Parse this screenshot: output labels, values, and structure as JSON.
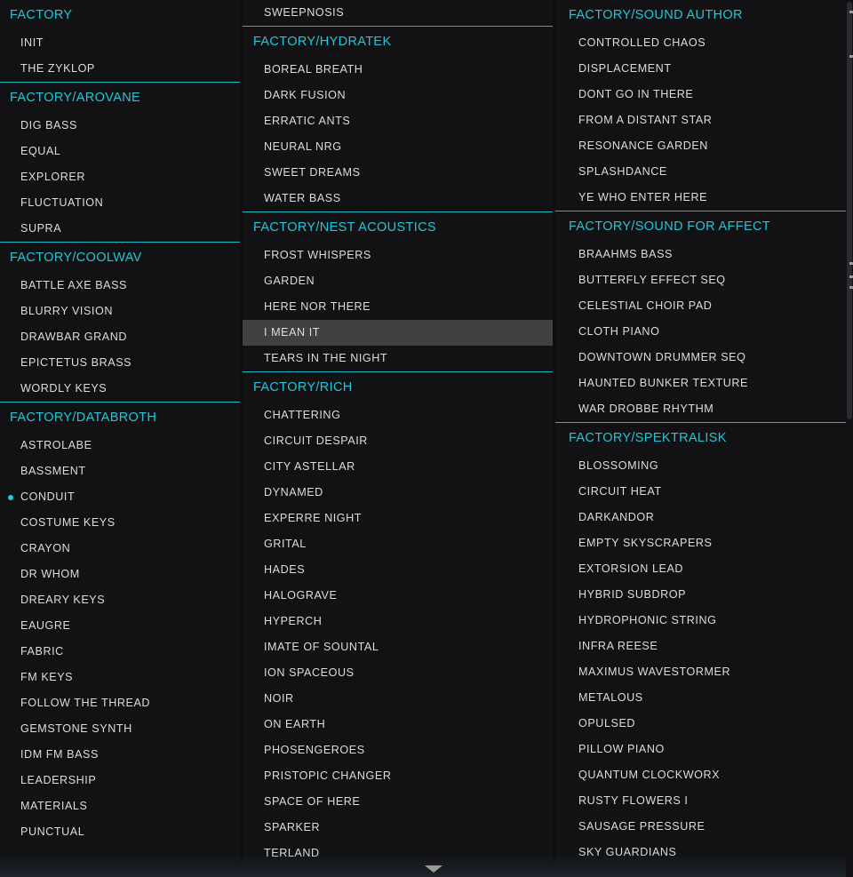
{
  "app": {
    "background_color": "#121214",
    "accent_color": "#23c6d6",
    "highlight_color": "#414141",
    "text_color": "#dcdcdc"
  },
  "columns": [
    {
      "id": "column-left",
      "groups": [
        {
          "header": "FACTORY",
          "rule_above": false,
          "items": [
            {
              "label": "INIT"
            },
            {
              "label": "THE ZYKLOP"
            }
          ]
        },
        {
          "header": "FACTORY/AROVANE",
          "rule_above": true,
          "items": [
            {
              "label": "DIG BASS"
            },
            {
              "label": "EQUAL"
            },
            {
              "label": "EXPLORER"
            },
            {
              "label": "FLUCTUATION"
            },
            {
              "label": "SUPRA"
            }
          ]
        },
        {
          "header": "FACTORY/COOLWAV",
          "rule_above": true,
          "items": [
            {
              "label": "BATTLE AXE BASS"
            },
            {
              "label": "BLURRY VISION"
            },
            {
              "label": "DRAWBAR GRAND"
            },
            {
              "label": "EPICTETUS BRASS"
            },
            {
              "label": "WORDLY KEYS"
            }
          ]
        },
        {
          "header": "FACTORY/DATABROTH",
          "rule_above": true,
          "items": [
            {
              "label": "ASTROLABE"
            },
            {
              "label": "BASSMENT"
            },
            {
              "label": "CONDUIT",
              "selected": true
            },
            {
              "label": "COSTUME KEYS"
            },
            {
              "label": "CRAYON"
            },
            {
              "label": "DR WHOM"
            },
            {
              "label": "DREARY KEYS"
            },
            {
              "label": "EAUGRE"
            },
            {
              "label": "FABRIC"
            },
            {
              "label": "FM KEYS"
            },
            {
              "label": "FOLLOW THE THREAD"
            },
            {
              "label": "GEMSTONE SYNTH"
            },
            {
              "label": "IDM FM BASS"
            },
            {
              "label": "LEADERSHIP"
            },
            {
              "label": "MATERIALS"
            },
            {
              "label": "PUNCTUAL"
            }
          ]
        }
      ]
    },
    {
      "id": "column-middle",
      "groups": [
        {
          "header": null,
          "rule_above": false,
          "items": [
            {
              "label": "SWEEPNOSIS"
            }
          ]
        },
        {
          "header": "FACTORY/HYDRATEK",
          "rule_above": true,
          "items": [
            {
              "label": "BOREAL BREATH"
            },
            {
              "label": "DARK FUSION"
            },
            {
              "label": "ERRATIC ANTS"
            },
            {
              "label": "NEURAL NRG"
            },
            {
              "label": "SWEET DREAMS"
            },
            {
              "label": "WATER BASS"
            }
          ]
        },
        {
          "header": "FACTORY/NEST ACOUSTICS",
          "rule_above": true,
          "items": [
            {
              "label": "FROST WHISPERS"
            },
            {
              "label": "GARDEN"
            },
            {
              "label": "HERE NOR THERE"
            },
            {
              "label": "I MEAN IT",
              "highlighted": true
            },
            {
              "label": "TEARS IN THE NIGHT"
            }
          ]
        },
        {
          "header": "FACTORY/RICH",
          "rule_above": true,
          "items": [
            {
              "label": "CHATTERING"
            },
            {
              "label": "CIRCUIT DESPAIR"
            },
            {
              "label": "CITY ASTELLAR"
            },
            {
              "label": "DYNAMED"
            },
            {
              "label": "EXPERRE NIGHT"
            },
            {
              "label": "GRITAL"
            },
            {
              "label": "HADES"
            },
            {
              "label": "HALOGRAVE"
            },
            {
              "label": "HYPERCH"
            },
            {
              "label": "IMATE OF SOUNTAL"
            },
            {
              "label": "ION SPACEOUS"
            },
            {
              "label": "NOIR"
            },
            {
              "label": "ON EARTH"
            },
            {
              "label": "PHOSENGEROES"
            },
            {
              "label": "PRISTOPIC CHANGER"
            },
            {
              "label": "SPACE OF HERE"
            },
            {
              "label": "SPARKER"
            },
            {
              "label": "TERLAND"
            }
          ]
        }
      ]
    },
    {
      "id": "column-right",
      "groups": [
        {
          "header": "FACTORY/SOUND AUTHOR",
          "rule_above": false,
          "items": [
            {
              "label": "CONTROLLED CHAOS"
            },
            {
              "label": "DISPLACEMENT"
            },
            {
              "label": "DONT GO IN THERE"
            },
            {
              "label": "FROM A DISTANT STAR"
            },
            {
              "label": "RESONANCE GARDEN"
            },
            {
              "label": "SPLASHDANCE"
            },
            {
              "label": "YE WHO ENTER HERE"
            }
          ]
        },
        {
          "header": "FACTORY/SOUND FOR AFFECT",
          "rule_above": true,
          "items": [
            {
              "label": "BRAAHMS BASS"
            },
            {
              "label": "BUTTERFLY EFFECT SEQ"
            },
            {
              "label": "CELESTIAL CHOIR PAD"
            },
            {
              "label": "CLOTH PIANO"
            },
            {
              "label": "DOWNTOWN DRUMMER SEQ"
            },
            {
              "label": "HAUNTED BUNKER TEXTURE"
            },
            {
              "label": "WAR DROBBE RHYTHM"
            }
          ]
        },
        {
          "header": "FACTORY/SPEKTRALISK",
          "rule_above": true,
          "items": [
            {
              "label": "BLOSSOMING"
            },
            {
              "label": "CIRCUIT HEAT"
            },
            {
              "label": "DARKANDOR"
            },
            {
              "label": "EMPTY SKYSCRAPERS"
            },
            {
              "label": "EXTORSION LEAD"
            },
            {
              "label": "HYBRID SUBDROP"
            },
            {
              "label": "HYDROPHONIC STRING"
            },
            {
              "label": "INFRA REESE"
            },
            {
              "label": "MAXIMUS WAVESTORMER"
            },
            {
              "label": "METALOUS"
            },
            {
              "label": "OPULSED"
            },
            {
              "label": "PILLOW PIANO"
            },
            {
              "label": "QUANTUM CLOCKWORX"
            },
            {
              "label": "RUSTY FLOWERS I"
            },
            {
              "label": "SAUSAGE PRESSURE"
            },
            {
              "label": "SKY GUARDIANS"
            }
          ]
        }
      ]
    }
  ],
  "scroll": {
    "down_arrow_icon": "chevron-down-icon"
  }
}
